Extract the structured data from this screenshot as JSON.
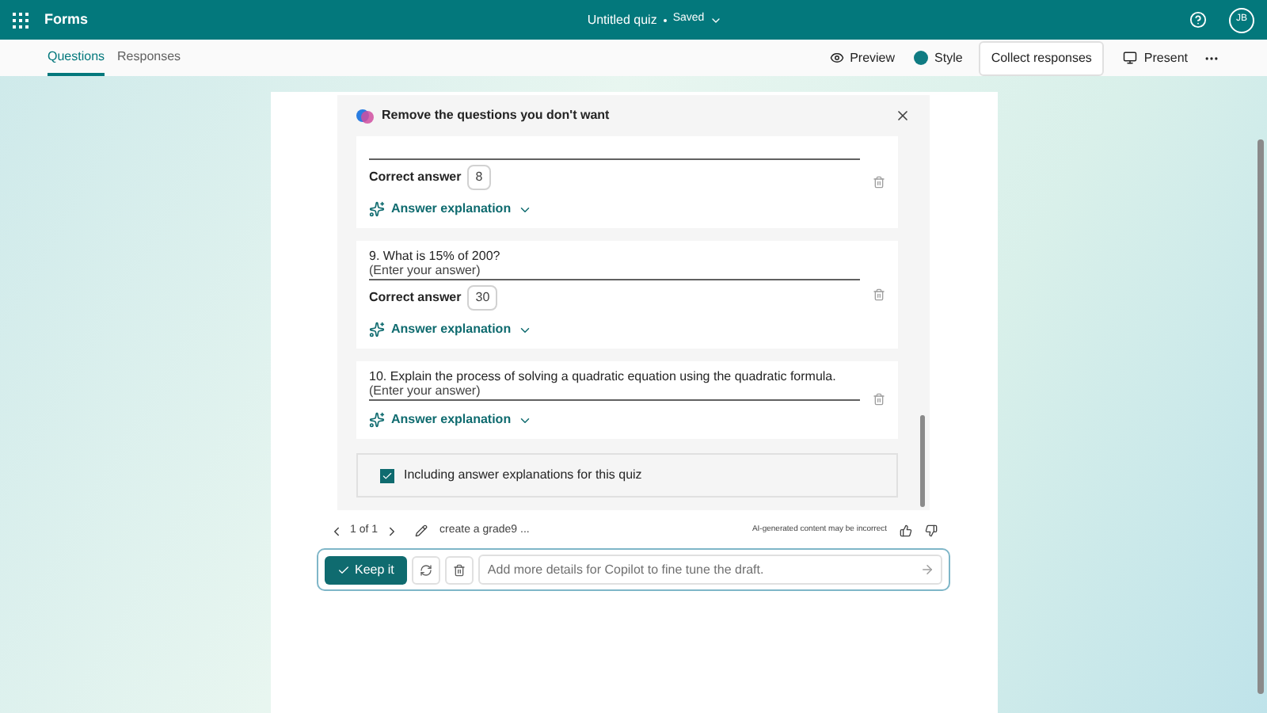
{
  "app": {
    "name": "Forms"
  },
  "document": {
    "title": "Untitled quiz",
    "status": "Saved"
  },
  "user": {
    "initials": "JB"
  },
  "tabs": [
    {
      "label": "Questions",
      "selected": true
    },
    {
      "label": "Responses",
      "selected": false
    }
  ],
  "toolbar": {
    "preview": "Preview",
    "style": "Style",
    "collect": "Collect responses",
    "present": "Present"
  },
  "copilot": {
    "title": "Remove the questions you don't want",
    "questions": [
      {
        "correct_label": "Correct answer",
        "correct_answer": "8",
        "explanation": "Answer explanation"
      },
      {
        "question": "9. What is 15% of 200?",
        "answer_hint": "(Enter your answer)",
        "correct_label": "Correct answer",
        "correct_answer": "30",
        "explanation": "Answer explanation"
      },
      {
        "question": "10. Explain the process of solving a quadratic equation using the quadratic formula.",
        "answer_hint": "(Enter your answer)",
        "explanation": "Answer explanation"
      }
    ],
    "option": {
      "label": "Including answer explanations for this quiz",
      "checked": true
    },
    "pager": "1 of 1",
    "prompt": "create a grade9 ...",
    "disclaimer": "AI-generated content may be incorrect",
    "keep": "Keep it",
    "input": {
      "placeholder": "Add more details for Copilot to fine tune the draft."
    }
  }
}
